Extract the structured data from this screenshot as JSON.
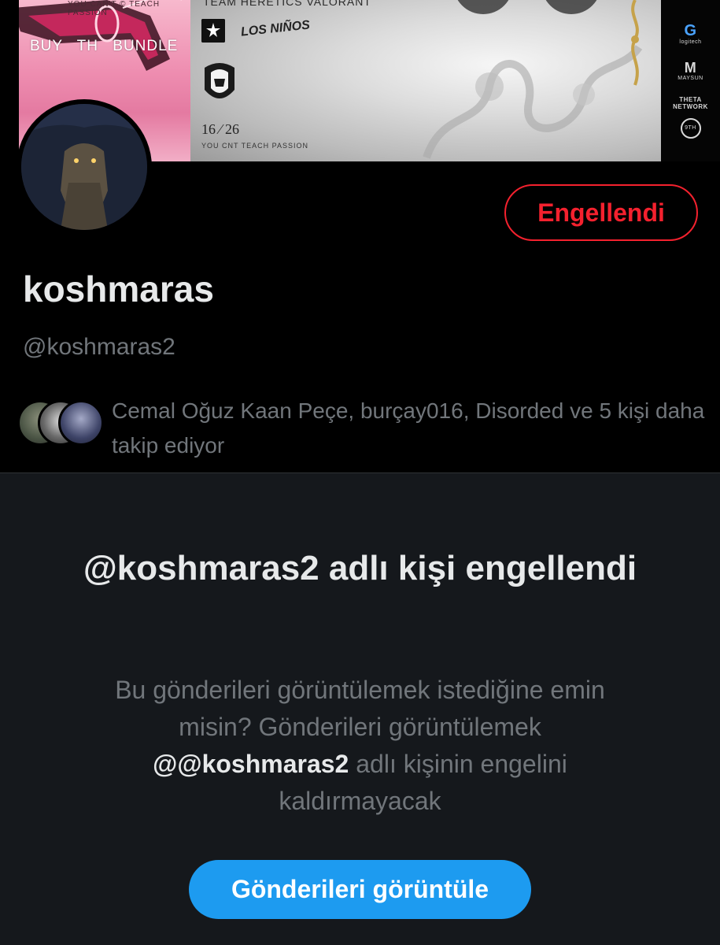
{
  "banner": {
    "promo_top_text": "YOU CAN'T  ©  TEACH PASSION",
    "buy_text": "BUY TH BUNDLE",
    "team_title": "TEAM HERETICS VALORANT",
    "sponsor_text": "LOS NIÑOS",
    "match_date": "16 ⁄ 26",
    "match_tagline": "YOU CNT  TEACH PASSION",
    "sponsors": [
      "logitech",
      "MAYSUN",
      "THETA NETWORK",
      "9TH"
    ]
  },
  "profile": {
    "display_name": "koshmaras",
    "handle": "@koshmaras2",
    "block_button_label": "Engellendi",
    "followed_by_text": "Cemal Oğuz Kaan Peçe, burçay016, Disorded ve 5 kişi daha takip ediyor"
  },
  "blocked_notice": {
    "title": "@koshmaras2 adlı kişi engellendi",
    "desc_prefix": "Bu gönderileri görüntülemek istediğine emin misin? Gönderileri görüntülemek ",
    "desc_handle": "@@koshmaras2",
    "desc_suffix": " adlı kişinin engelini kaldırmayacak",
    "view_button_label": "Gönderileri görüntüle"
  },
  "colors": {
    "accent_blue": "#1d9bf0",
    "block_red": "#f4212e",
    "secondary_text": "#71767b",
    "panel_bg": "#15181c"
  }
}
